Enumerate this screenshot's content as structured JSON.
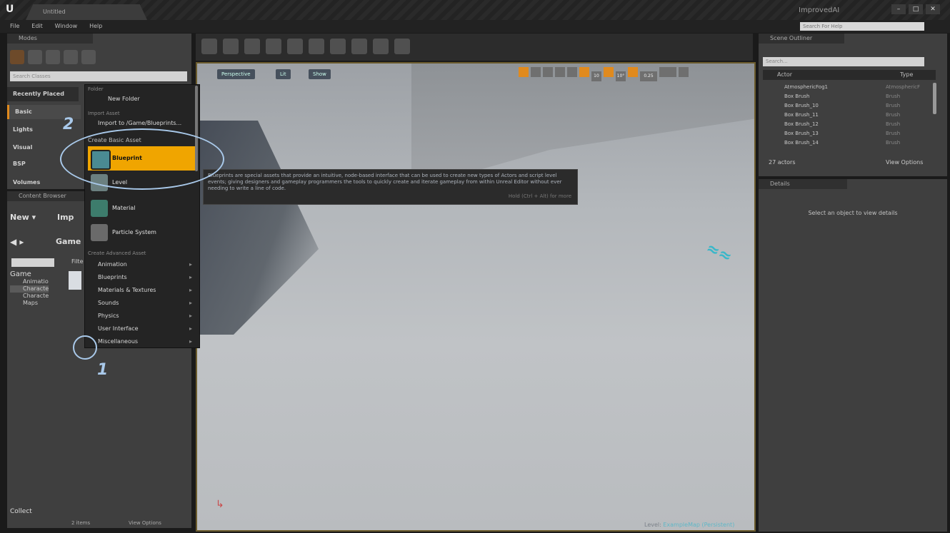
{
  "titlebar": {
    "doc_tab": "Untitled",
    "project": "ImprovedAI"
  },
  "menubar": [
    "File",
    "Edit",
    "Window",
    "Help"
  ],
  "help_search": "Search For Help",
  "modes": {
    "tab": "Modes",
    "search_placeholder": "Search Classes",
    "categories": [
      "Recently Placed",
      "Basic",
      "Lights",
      "Visual",
      "BSP",
      "Volumes"
    ]
  },
  "content_browser": {
    "tab": "Content Browser",
    "new_label": "New",
    "import_label": "Imp",
    "path": "Game",
    "filters": "Filte",
    "tree_root": "Game",
    "tree_items": [
      "Animatio",
      "Characte",
      "Characte",
      "Maps"
    ],
    "item_count": "2 items",
    "view_options": "View Options",
    "collections": "Collect"
  },
  "menu": {
    "folder_section": "Folder",
    "new_folder": "New Folder",
    "import_section": "Import Asset",
    "import_item": "Import to /Game/Blueprints...",
    "basic_section": "Create Basic Asset",
    "basic_items": [
      "Blueprint",
      "Level",
      "Material",
      "Particle System"
    ],
    "advanced_section": "Create Advanced Asset",
    "advanced_items": [
      "Animation",
      "Blueprints",
      "Materials & Textures",
      "Sounds",
      "Physics",
      "User Interface",
      "Miscellaneous"
    ]
  },
  "tooltip": {
    "text": "Blueprints are special assets that provide an intuitive, node-based interface that can be used to create new types of Actors and script level events; giving designers and gameplay programmers the tools to quickly create and iterate gameplay from within Unreal Editor without ever needing to write a line of code.",
    "hint": "Hold (Ctrl + Alt) for more"
  },
  "viewport": {
    "perspective": "Perspective",
    "lit": "Lit",
    "show": "Show",
    "level_label": "Level:",
    "level_name": "ExampleMap (Persistent)",
    "snap_values": [
      "10",
      "10°",
      "0.25"
    ]
  },
  "outliner": {
    "tab": "Scene Outliner",
    "search_placeholder": "Search...",
    "col_actor": "Actor",
    "col_type": "Type",
    "rows": [
      {
        "name": "AtmosphericFog1",
        "type": "AtmosphericF"
      },
      {
        "name": "Box Brush",
        "type": "Brush"
      },
      {
        "name": "Box Brush_10",
        "type": "Brush"
      },
      {
        "name": "Box Brush_11",
        "type": "Brush"
      },
      {
        "name": "Box Brush_12",
        "type": "Brush"
      },
      {
        "name": "Box Brush_13",
        "type": "Brush"
      },
      {
        "name": "Box Brush_14",
        "type": "Brush"
      }
    ],
    "actor_count": "27 actors",
    "view_options": "View Options"
  },
  "details": {
    "tab": "Details",
    "message": "Select an object to view details"
  },
  "annotations": {
    "one": "1",
    "two": "2"
  },
  "colors": {
    "highlight": "#f0a500",
    "annotation": "#a9c9ea",
    "viewport_border": "#6b5b2c"
  }
}
